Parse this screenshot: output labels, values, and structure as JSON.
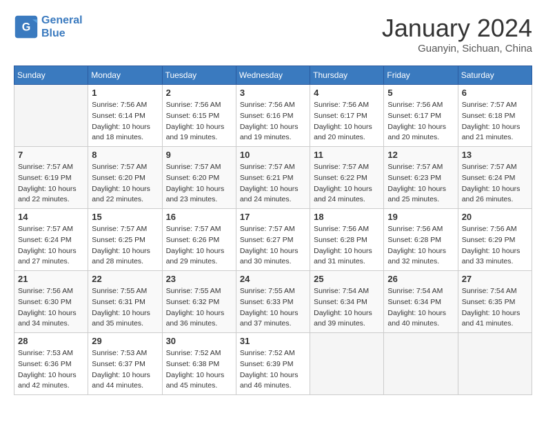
{
  "header": {
    "logo_line1": "General",
    "logo_line2": "Blue",
    "month": "January 2024",
    "location": "Guanyin, Sichuan, China"
  },
  "days_of_week": [
    "Sunday",
    "Monday",
    "Tuesday",
    "Wednesday",
    "Thursday",
    "Friday",
    "Saturday"
  ],
  "weeks": [
    [
      {
        "num": "",
        "sunrise": "",
        "sunset": "",
        "daylight": ""
      },
      {
        "num": "1",
        "sunrise": "Sunrise: 7:56 AM",
        "sunset": "Sunset: 6:14 PM",
        "daylight": "Daylight: 10 hours and 18 minutes."
      },
      {
        "num": "2",
        "sunrise": "Sunrise: 7:56 AM",
        "sunset": "Sunset: 6:15 PM",
        "daylight": "Daylight: 10 hours and 19 minutes."
      },
      {
        "num": "3",
        "sunrise": "Sunrise: 7:56 AM",
        "sunset": "Sunset: 6:16 PM",
        "daylight": "Daylight: 10 hours and 19 minutes."
      },
      {
        "num": "4",
        "sunrise": "Sunrise: 7:56 AM",
        "sunset": "Sunset: 6:17 PM",
        "daylight": "Daylight: 10 hours and 20 minutes."
      },
      {
        "num": "5",
        "sunrise": "Sunrise: 7:56 AM",
        "sunset": "Sunset: 6:17 PM",
        "daylight": "Daylight: 10 hours and 20 minutes."
      },
      {
        "num": "6",
        "sunrise": "Sunrise: 7:57 AM",
        "sunset": "Sunset: 6:18 PM",
        "daylight": "Daylight: 10 hours and 21 minutes."
      }
    ],
    [
      {
        "num": "7",
        "sunrise": "Sunrise: 7:57 AM",
        "sunset": "Sunset: 6:19 PM",
        "daylight": "Daylight: 10 hours and 22 minutes."
      },
      {
        "num": "8",
        "sunrise": "Sunrise: 7:57 AM",
        "sunset": "Sunset: 6:20 PM",
        "daylight": "Daylight: 10 hours and 22 minutes."
      },
      {
        "num": "9",
        "sunrise": "Sunrise: 7:57 AM",
        "sunset": "Sunset: 6:20 PM",
        "daylight": "Daylight: 10 hours and 23 minutes."
      },
      {
        "num": "10",
        "sunrise": "Sunrise: 7:57 AM",
        "sunset": "Sunset: 6:21 PM",
        "daylight": "Daylight: 10 hours and 24 minutes."
      },
      {
        "num": "11",
        "sunrise": "Sunrise: 7:57 AM",
        "sunset": "Sunset: 6:22 PM",
        "daylight": "Daylight: 10 hours and 24 minutes."
      },
      {
        "num": "12",
        "sunrise": "Sunrise: 7:57 AM",
        "sunset": "Sunset: 6:23 PM",
        "daylight": "Daylight: 10 hours and 25 minutes."
      },
      {
        "num": "13",
        "sunrise": "Sunrise: 7:57 AM",
        "sunset": "Sunset: 6:24 PM",
        "daylight": "Daylight: 10 hours and 26 minutes."
      }
    ],
    [
      {
        "num": "14",
        "sunrise": "Sunrise: 7:57 AM",
        "sunset": "Sunset: 6:24 PM",
        "daylight": "Daylight: 10 hours and 27 minutes."
      },
      {
        "num": "15",
        "sunrise": "Sunrise: 7:57 AM",
        "sunset": "Sunset: 6:25 PM",
        "daylight": "Daylight: 10 hours and 28 minutes."
      },
      {
        "num": "16",
        "sunrise": "Sunrise: 7:57 AM",
        "sunset": "Sunset: 6:26 PM",
        "daylight": "Daylight: 10 hours and 29 minutes."
      },
      {
        "num": "17",
        "sunrise": "Sunrise: 7:57 AM",
        "sunset": "Sunset: 6:27 PM",
        "daylight": "Daylight: 10 hours and 30 minutes."
      },
      {
        "num": "18",
        "sunrise": "Sunrise: 7:56 AM",
        "sunset": "Sunset: 6:28 PM",
        "daylight": "Daylight: 10 hours and 31 minutes."
      },
      {
        "num": "19",
        "sunrise": "Sunrise: 7:56 AM",
        "sunset": "Sunset: 6:28 PM",
        "daylight": "Daylight: 10 hours and 32 minutes."
      },
      {
        "num": "20",
        "sunrise": "Sunrise: 7:56 AM",
        "sunset": "Sunset: 6:29 PM",
        "daylight": "Daylight: 10 hours and 33 minutes."
      }
    ],
    [
      {
        "num": "21",
        "sunrise": "Sunrise: 7:56 AM",
        "sunset": "Sunset: 6:30 PM",
        "daylight": "Daylight: 10 hours and 34 minutes."
      },
      {
        "num": "22",
        "sunrise": "Sunrise: 7:55 AM",
        "sunset": "Sunset: 6:31 PM",
        "daylight": "Daylight: 10 hours and 35 minutes."
      },
      {
        "num": "23",
        "sunrise": "Sunrise: 7:55 AM",
        "sunset": "Sunset: 6:32 PM",
        "daylight": "Daylight: 10 hours and 36 minutes."
      },
      {
        "num": "24",
        "sunrise": "Sunrise: 7:55 AM",
        "sunset": "Sunset: 6:33 PM",
        "daylight": "Daylight: 10 hours and 37 minutes."
      },
      {
        "num": "25",
        "sunrise": "Sunrise: 7:54 AM",
        "sunset": "Sunset: 6:34 PM",
        "daylight": "Daylight: 10 hours and 39 minutes."
      },
      {
        "num": "26",
        "sunrise": "Sunrise: 7:54 AM",
        "sunset": "Sunset: 6:34 PM",
        "daylight": "Daylight: 10 hours and 40 minutes."
      },
      {
        "num": "27",
        "sunrise": "Sunrise: 7:54 AM",
        "sunset": "Sunset: 6:35 PM",
        "daylight": "Daylight: 10 hours and 41 minutes."
      }
    ],
    [
      {
        "num": "28",
        "sunrise": "Sunrise: 7:53 AM",
        "sunset": "Sunset: 6:36 PM",
        "daylight": "Daylight: 10 hours and 42 minutes."
      },
      {
        "num": "29",
        "sunrise": "Sunrise: 7:53 AM",
        "sunset": "Sunset: 6:37 PM",
        "daylight": "Daylight: 10 hours and 44 minutes."
      },
      {
        "num": "30",
        "sunrise": "Sunrise: 7:52 AM",
        "sunset": "Sunset: 6:38 PM",
        "daylight": "Daylight: 10 hours and 45 minutes."
      },
      {
        "num": "31",
        "sunrise": "Sunrise: 7:52 AM",
        "sunset": "Sunset: 6:39 PM",
        "daylight": "Daylight: 10 hours and 46 minutes."
      },
      {
        "num": "",
        "sunrise": "",
        "sunset": "",
        "daylight": ""
      },
      {
        "num": "",
        "sunrise": "",
        "sunset": "",
        "daylight": ""
      },
      {
        "num": "",
        "sunrise": "",
        "sunset": "",
        "daylight": ""
      }
    ]
  ]
}
